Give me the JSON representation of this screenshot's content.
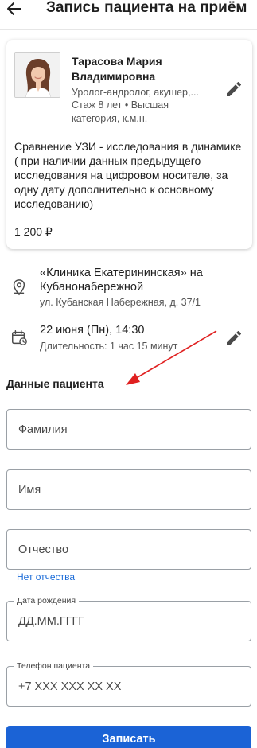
{
  "header": {
    "title": "Запись пациента на приём"
  },
  "doctor": {
    "name": "Тарасова Мария Владимировна",
    "specialty": "Уролог-андролог, акушер,...",
    "experience": "Стаж 8 лет • Высшая категория, к.м.н."
  },
  "service": {
    "description": "Сравнение УЗИ - исследования в динамике ( при наличии данных предыдущего исследования на цифровом носителе, за одну дату дополнительно к основному исследованию)",
    "price": "1 200 ₽"
  },
  "clinic": {
    "name": "«Клиника Екатерининская» на Кубанонабережной",
    "address": "ул. Кубанская Набережная, д. 37/1"
  },
  "appointment": {
    "date": "22 июня (Пн), 14:30",
    "duration": "Длительность: 1 час 15 минут"
  },
  "patient": {
    "section_title": "Данные пациента",
    "last_name_placeholder": "Фамилия",
    "first_name_placeholder": "Имя",
    "patronymic_placeholder": "Отчество",
    "no_patronymic_link": "Нет отчества",
    "birth_date_label": "Дата рождения",
    "birth_date_placeholder": "ДД.ММ.ГГГГ",
    "phone_label": "Телефон пациента",
    "phone_placeholder": "+7 XXX XXX XX XX"
  },
  "submit": {
    "label": "Записать"
  },
  "colors": {
    "accent": "#1b63d6",
    "link": "#1a6bd8",
    "annotation_arrow": "#e02020"
  },
  "icons": [
    "arrow-left-icon",
    "pencil-icon",
    "location-pin-icon",
    "calendar-clock-icon"
  ]
}
